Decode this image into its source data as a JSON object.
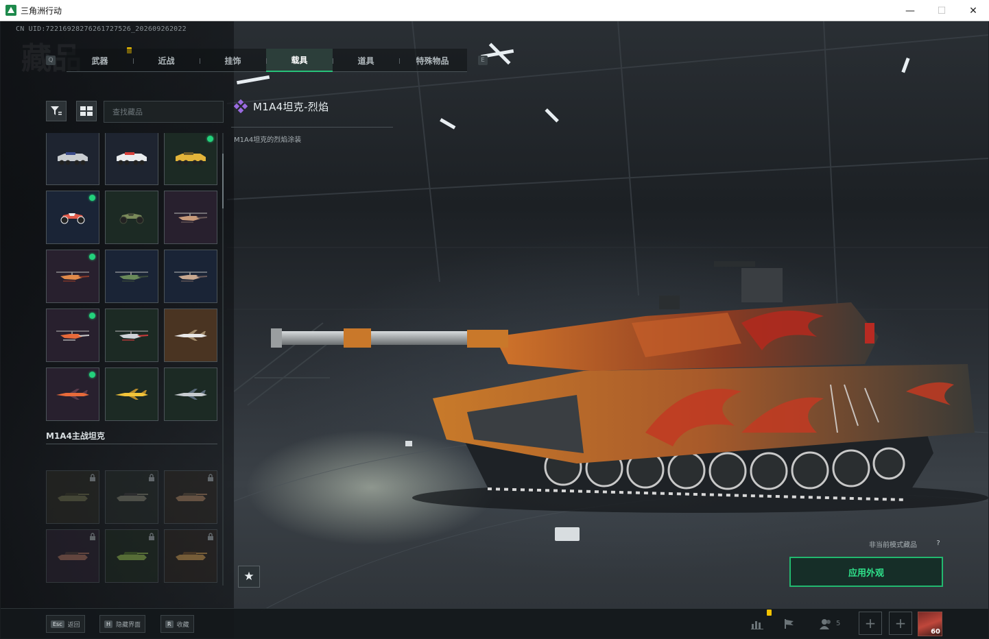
{
  "window": {
    "title": "三角洲行动",
    "minimize": "—",
    "maximize": "☐",
    "close": "✕"
  },
  "uid_text": "CN UID:7221692827626172752­6_202609262022",
  "bg_title": "藏品",
  "tabs": [
    {
      "label": "武器",
      "active": false
    },
    {
      "label": "近战",
      "active": false
    },
    {
      "label": "挂饰",
      "active": false
    },
    {
      "label": "载具",
      "active": true
    },
    {
      "label": "道具",
      "active": false
    },
    {
      "label": "特殊物品",
      "active": false
    }
  ],
  "tab_keys": {
    "left": "Q",
    "right": "E"
  },
  "search": {
    "placeholder": "查找藏品",
    "value": ""
  },
  "grid_top": [
    {
      "icon": "armored-vehicle-icon",
      "colors": [
        "#c8ccd0",
        "#3a4a8a"
      ],
      "dot": false,
      "bg": "#1e2430"
    },
    {
      "icon": "armored-vehicle-icon",
      "colors": [
        "#e9ecee",
        "#d8403a"
      ],
      "dot": false,
      "bg": "#1e2430"
    },
    {
      "icon": "armored-vehicle-icon",
      "colors": [
        "#e2b43a",
        "#6a5a2a"
      ],
      "dot": true,
      "bg": "#1c2a24"
    },
    {
      "icon": "atv-icon",
      "colors": [
        "#e05a4a",
        "#f0f0f0"
      ],
      "dot": true,
      "bg": "#1a2436"
    },
    {
      "icon": "atv-icon",
      "colors": [
        "#7a8a5a",
        "#444a3a"
      ],
      "dot": false,
      "bg": "#1c2a24"
    },
    {
      "icon": "helicopter-icon",
      "colors": [
        "#c89a7a",
        "#6a5a5a"
      ],
      "dot": false,
      "bg": "#28202e"
    },
    {
      "icon": "helicopter-icon",
      "colors": [
        "#e08a4a",
        "#8a3a2a"
      ],
      "dot": true,
      "bg": "#28202e"
    },
    {
      "icon": "helicopter-icon",
      "colors": [
        "#6a8a5a",
        "#3a4a3a"
      ],
      "dot": false,
      "bg": "#1a2436"
    },
    {
      "icon": "helicopter-icon",
      "colors": [
        "#c8a890",
        "#6a5a5a"
      ],
      "dot": false,
      "bg": "#1a2436"
    },
    {
      "icon": "helicopter-icon",
      "colors": [
        "#e86a3a",
        "#c8c8c8"
      ],
      "dot": true,
      "bg": "#28202e"
    },
    {
      "icon": "helicopter-icon",
      "colors": [
        "#d0d4d8",
        "#c83a3a"
      ],
      "dot": false,
      "bg": "#1c2a24"
    },
    {
      "icon": "jet-icon",
      "colors": [
        "#e8e8e8",
        "#a08a6a"
      ],
      "dot": false,
      "bg": "#4a3422"
    },
    {
      "icon": "jet-icon",
      "colors": [
        "#e86a3a",
        "#5a3a4a"
      ],
      "dot": true,
      "bg": "#28202e"
    },
    {
      "icon": "jet-icon",
      "colors": [
        "#f2c43a",
        "#b88a2a"
      ],
      "dot": false,
      "bg": "#1c2a24"
    },
    {
      "icon": "jet-icon",
      "colors": [
        "#c8ccd0",
        "#5a6a7a"
      ],
      "dot": false,
      "bg": "#1c2a24"
    }
  ],
  "section_title": "M1A4主战坦克",
  "grid_tank": [
    {
      "icon": "tank-icon",
      "colors": [
        "#6a6a4a",
        "#3a3a2a"
      ],
      "bg": "#2a2a24"
    },
    {
      "icon": "tank-icon",
      "colors": [
        "#7a7a6a",
        "#3a3a3a"
      ],
      "bg": "#242a28"
    },
    {
      "icon": "tank-icon",
      "colors": [
        "#a07a5a",
        "#5a4a3a"
      ],
      "bg": "#2a2622"
    },
    {
      "icon": "tank-icon",
      "colors": [
        "#a06a5a",
        "#4a3a3a"
      ],
      "bg": "#2a2230"
    },
    {
      "icon": "tank-icon",
      "colors": [
        "#8ab04a",
        "#4a6a2a"
      ],
      "bg": "#1e2a20"
    },
    {
      "icon": "tank-icon",
      "colors": [
        "#c0904a",
        "#6a4a2a"
      ],
      "bg": "#2a2420"
    },
    {
      "icon": "tank-icon",
      "colors": [
        "#8a8a8a",
        "#4a4a4a"
      ],
      "bg": "#2a2230"
    },
    {
      "icon": "tank-icon",
      "colors": [
        "#8a8a8a",
        "#4a4a4a"
      ],
      "bg": "#242a28"
    },
    {
      "icon": "tank-icon",
      "colors": [
        "#8a8a8a",
        "#4a4a4a"
      ],
      "bg": "#242a28"
    }
  ],
  "item": {
    "name": "M1A4坦克-烈焰",
    "description": "M1A4坦克的烈焰涂装",
    "rarity_color": "#9a6ae0"
  },
  "non_mode_label": "非当前模式藏品",
  "help_mark": "?",
  "apply_label": "应用外观",
  "accent_color": "#22b96f",
  "bottom_hints": [
    {
      "key": "Esc",
      "label": "返回"
    },
    {
      "key": "H",
      "label": "隐藏界面"
    },
    {
      "key": "R",
      "label": "收藏"
    }
  ],
  "friends_count": "5",
  "player_level": "60",
  "star_label": "★",
  "plus_label": "+"
}
